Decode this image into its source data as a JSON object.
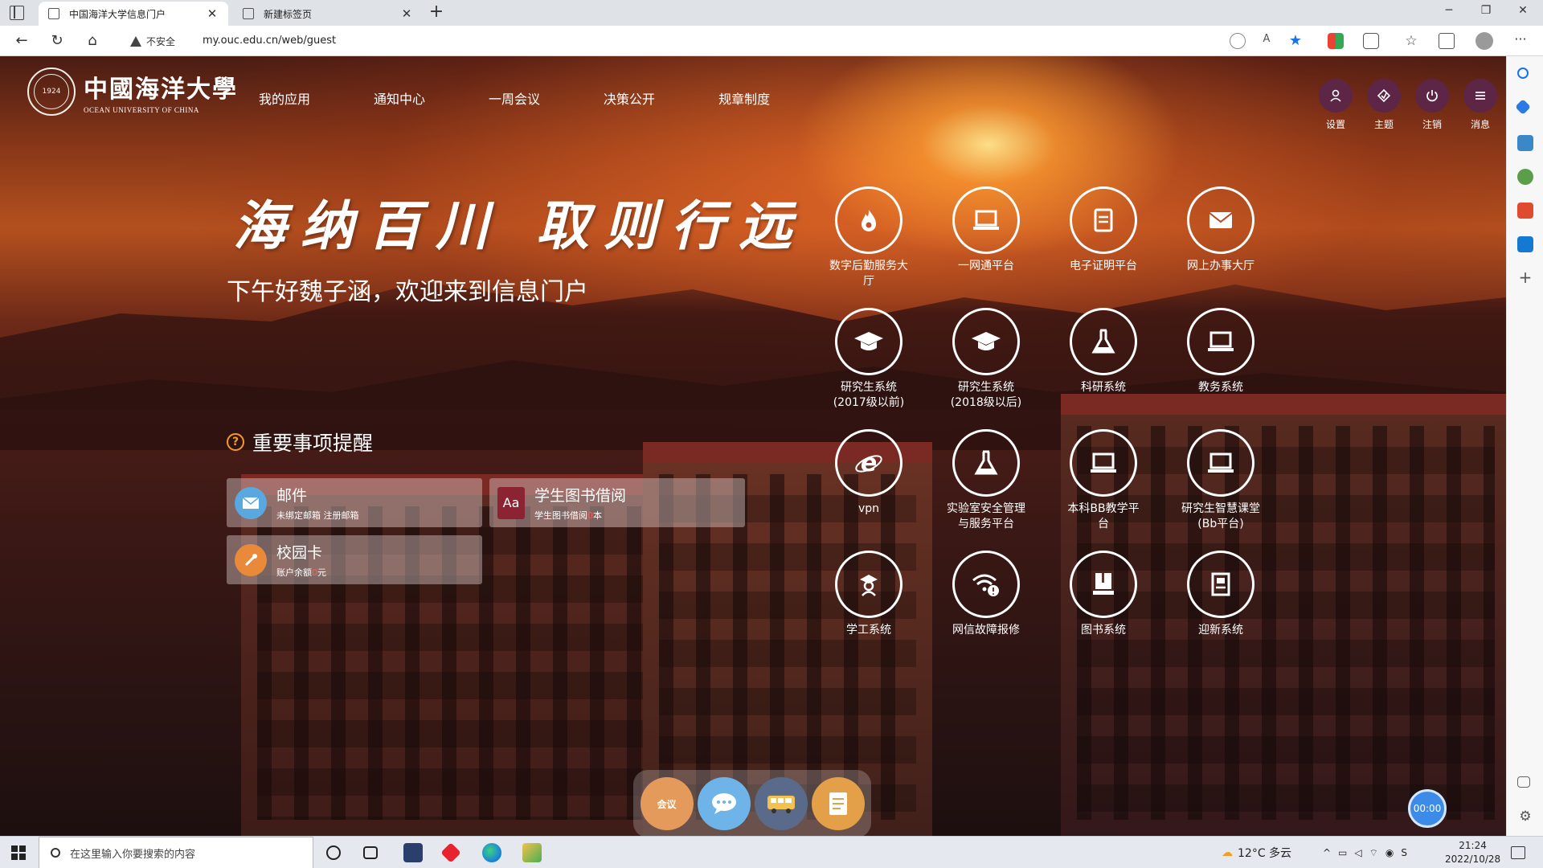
{
  "browser": {
    "tabs": [
      {
        "title": "中国海洋大学信息门户",
        "active": true
      },
      {
        "title": "新建标签页",
        "active": false
      }
    ],
    "warning": "不安全",
    "url": "my.ouc.edu.cn/web/guest"
  },
  "header": {
    "logo_cn": "中國海洋大學",
    "logo_en": "OCEAN UNIVERSITY OF CHINA",
    "emblem_year": "1924",
    "nav": [
      "我的应用",
      "通知中心",
      "一周会议",
      "决策公开",
      "规章制度"
    ],
    "tools": [
      {
        "label": "设置",
        "icon": "user-icon"
      },
      {
        "label": "主题",
        "icon": "theme-icon"
      },
      {
        "label": "注销",
        "icon": "power-icon"
      },
      {
        "label": "消息",
        "icon": "menu-icon"
      }
    ]
  },
  "hero": {
    "slogan": "海纳百川 取则行远",
    "greeting": "下午好魏子涵，欢迎来到信息门户"
  },
  "reminders": {
    "title": "重要事项提醒",
    "cards": [
      {
        "name": "邮件",
        "sub_pre": "未绑定邮箱 注册邮箱",
        "value": "",
        "sub_post": "",
        "icon": "mail-icon",
        "color": "#5aa8e0"
      },
      {
        "name": "学生图书借阅",
        "sub_pre": "学生图书借阅",
        "value": "0",
        "sub_post": "本",
        "icon": "book-icon",
        "color": "#8b2332"
      },
      {
        "name": "校园卡",
        "sub_pre": "账户余额",
        "value": "0",
        "sub_post": "元",
        "icon": "card-icon",
        "color": "#e98a3a"
      }
    ]
  },
  "apps": [
    {
      "label": "数字后勤服务大厅",
      "icon": "flame-icon"
    },
    {
      "label": "一网通平台",
      "icon": "laptop-icon"
    },
    {
      "label": "电子证明平台",
      "icon": "certificate-icon"
    },
    {
      "label": "网上办事大厅",
      "icon": "envelope-icon"
    },
    {
      "label": "研究生系统(2017级以前)",
      "icon": "graduation-cap-icon"
    },
    {
      "label": "研究生系统(2018级以后)",
      "icon": "graduation-cap-icon"
    },
    {
      "label": "科研系统",
      "icon": "flask-icon"
    },
    {
      "label": "教务系统",
      "icon": "laptop-icon"
    },
    {
      "label": "vpn",
      "icon": "ie-icon"
    },
    {
      "label": "实验室安全管理与服务平台",
      "icon": "flask-icon"
    },
    {
      "label": "本科BB教学平台",
      "icon": "laptop-icon"
    },
    {
      "label": "研究生智慧课堂(Bb平台)",
      "icon": "laptop-icon"
    },
    {
      "label": "学工系统",
      "icon": "student-icon"
    },
    {
      "label": "网信故障报修",
      "icon": "wifi-alert-icon"
    },
    {
      "label": "图书系统",
      "icon": "books-icon"
    },
    {
      "label": "迎新系统",
      "icon": "document-icon"
    }
  ],
  "dock": [
    {
      "label": "会议",
      "icon": "meeting-icon",
      "color": "#e39a5a"
    },
    {
      "label": "",
      "icon": "chat-icon",
      "color": "#6fb4e8"
    },
    {
      "label": "",
      "icon": "bus-icon",
      "color": "#5a6a8a"
    },
    {
      "label": "",
      "icon": "document-icon",
      "color": "#e3a048"
    }
  ],
  "timer": "00:00",
  "taskbar": {
    "search_placeholder": "在这里输入你要搜索的内容",
    "weather": "12°C 多云",
    "time": "21:24",
    "date": "2022/10/28"
  }
}
